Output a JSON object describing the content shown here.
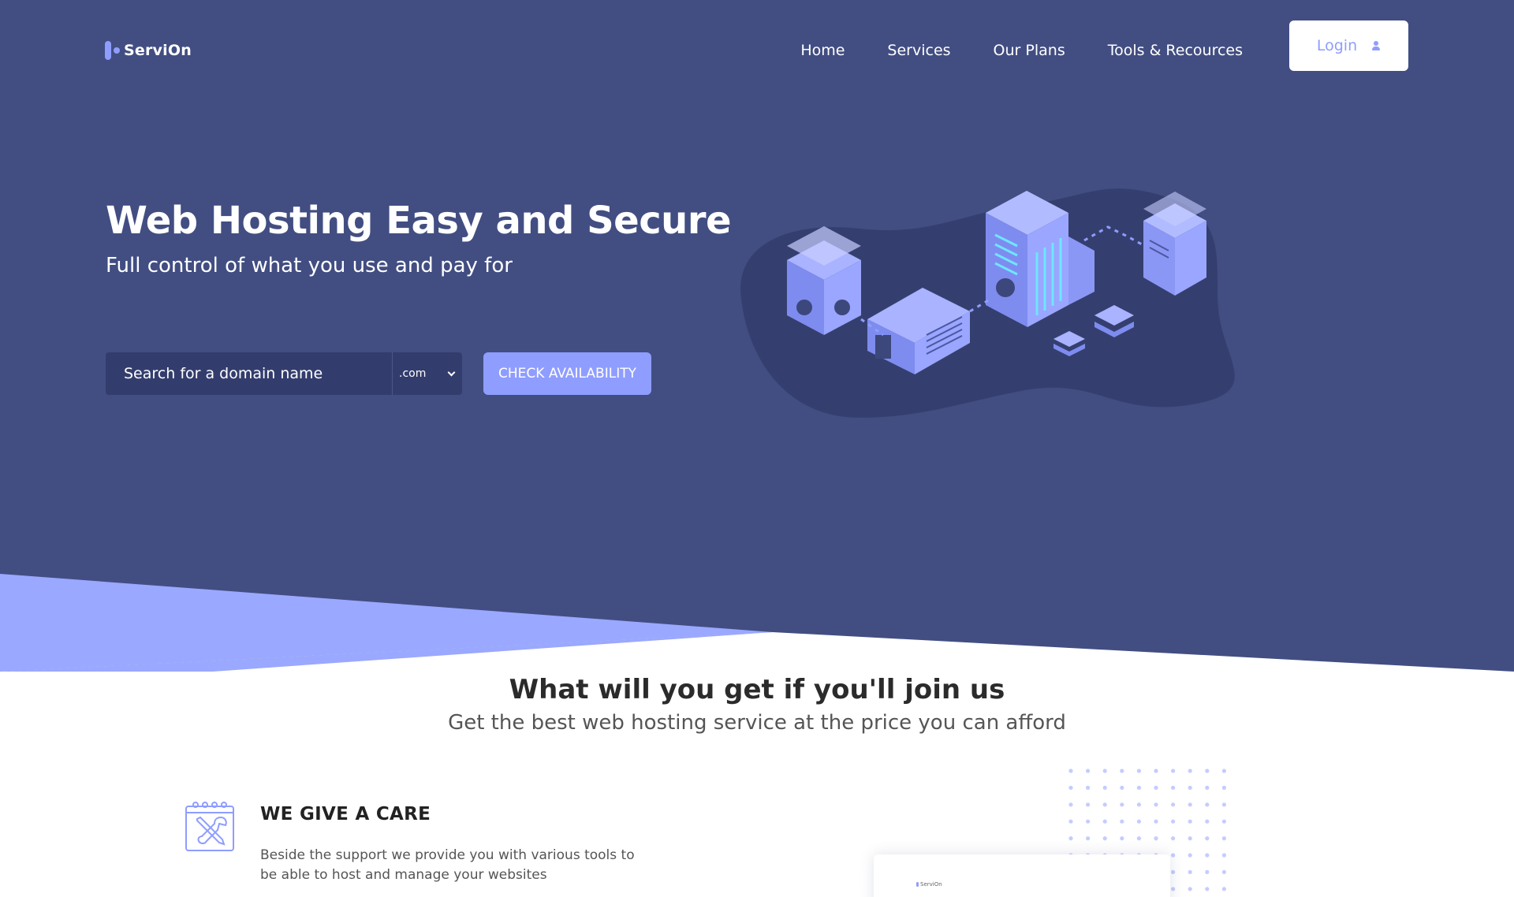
{
  "brand": {
    "name": "ServiOn"
  },
  "nav": {
    "items": [
      {
        "label": "Home"
      },
      {
        "label": "Services"
      },
      {
        "label": "Our Plans"
      },
      {
        "label": "Tools & Recources"
      }
    ],
    "login_label": "Login"
  },
  "hero": {
    "title": "Web Hosting Easy and Secure",
    "subtitle": "Full control of what you use and pay for",
    "search": {
      "placeholder": "Search for a domain name",
      "tld_selected": ".com"
    },
    "cta_label": "CHECK AVAILABILITY"
  },
  "section": {
    "title": "What will you get if you'll join us",
    "subtitle": "Get the best web hosting service at the price you can afford"
  },
  "features": [
    {
      "title": "WE GIVE A CARE",
      "text": "Beside the support we provide you with various tools to be able to host and manage your websites",
      "icon": "tools-icon"
    }
  ],
  "preview": {
    "brand": "ServiOn"
  },
  "colors": {
    "hero_bg": "#424e82",
    "accent": "#8f9dff",
    "input_bg": "#333d6d",
    "blob": "#353f6f"
  }
}
